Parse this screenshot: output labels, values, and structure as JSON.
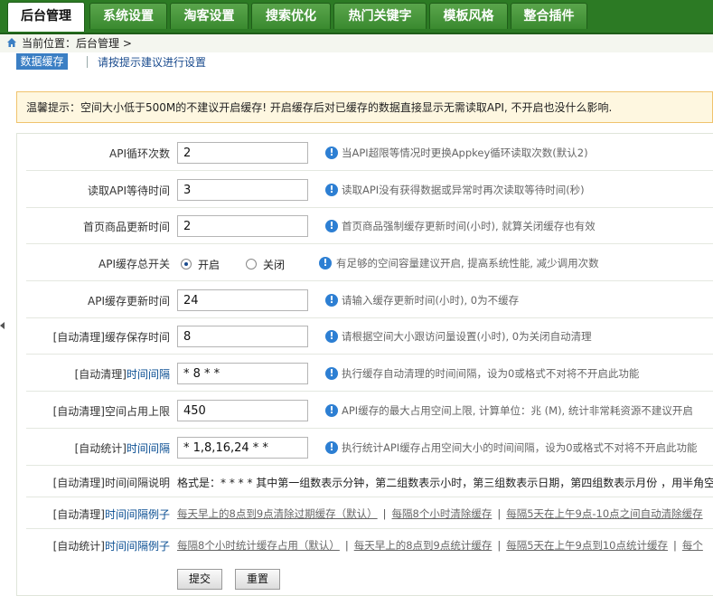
{
  "tabs": [
    {
      "label": "后台管理",
      "active": true
    },
    {
      "label": "系统设置"
    },
    {
      "label": "淘客设置"
    },
    {
      "label": "搜索优化"
    },
    {
      "label": "热门关键字"
    },
    {
      "label": "模板风格"
    },
    {
      "label": "整合插件"
    }
  ],
  "breadcrumb": {
    "text": "当前位置：后台管理 >"
  },
  "subnav": {
    "active_tab": "数据缓存",
    "tip": "请按提示建议进行设置"
  },
  "notice": "温馨提示：空间大小低于500M的不建议开启缓存!  开启缓存后对已缓存的数据直接显示无需读取API, 不开启也没什么影响.",
  "rows": [
    {
      "label": "API循环次数",
      "value": "2",
      "hint": "当API超限等情况时更换Appkey循环读取次数(默认2)"
    },
    {
      "label": "读取API等待时间",
      "value": "3",
      "hint": "读取API没有获得数据或异常时再次读取等待时间(秒)"
    },
    {
      "label": "首页商品更新时间",
      "value": "2",
      "hint": "首页商品强制缓存更新时间(小时), 就算关闭缓存也有效"
    },
    {
      "label": "API缓存总开关",
      "options": [
        "开启",
        "关闭"
      ],
      "selected": "开启",
      "hint": "有足够的空间容量建议开启, 提高系统性能, 减少调用次数"
    },
    {
      "label": "API缓存更新时间",
      "value": "24",
      "hint": "请输入缓存更新时间(小时), 0为不缓存"
    },
    {
      "label": "[自动清理]缓存保存时间",
      "value": "8",
      "hint": "请根据空间大小跟访问量设置(小时), 0为关闭自动清理"
    },
    {
      "label_prefix": "[自动清理]",
      "label_highlight": "时间间隔",
      "value": "* 8 * *",
      "hint": "执行缓存自动清理的时间间隔，设为0或格式不对将不开启此功能"
    },
    {
      "label": "[自动清理]空间占用上限",
      "value": "450",
      "hint": "API缓存的最大占用空间上限, 计算单位：兆 (M), 统计非常耗资源不建议开启"
    },
    {
      "label_prefix": "[自动统计]",
      "label_highlight": "时间间隔",
      "value": "* 1,8,16,24 * *",
      "hint": "执行统计API缓存占用空间大小的时间间隔，设为0或格式不对将不开启此功能"
    },
    {
      "label": "[自动清理]时间间隔说明",
      "text": "格式是：* * * * 其中第一组数表示分钟，第二组数表示小时，第三组数表示日期，第四组数表示月份 ，用半角空格"
    },
    {
      "label_prefix": "[自动清理]",
      "label_highlight": "时间间隔例子",
      "links": [
        "每天早上的8点到9点清除过期缓存（默认）",
        "每隔8个小时清除缓存",
        "每隔5天在上午9点-10点之间自动清除缓存"
      ]
    },
    {
      "label_prefix": "[自动统计]",
      "label_highlight": "时间间隔例子",
      "links": [
        "每隔8个小时统计缓存占用（默认）",
        "每天早上的8点到9点统计缓存",
        "每隔5天在上午9点到10点统计缓存",
        "每个"
      ]
    }
  ],
  "buttons": {
    "submit": "提交",
    "reset": "重置"
  },
  "colors": {
    "nav_green": "#2c7a24",
    "accent_blue": "#3b7fc4",
    "info_icon": "#2d7fd3"
  }
}
